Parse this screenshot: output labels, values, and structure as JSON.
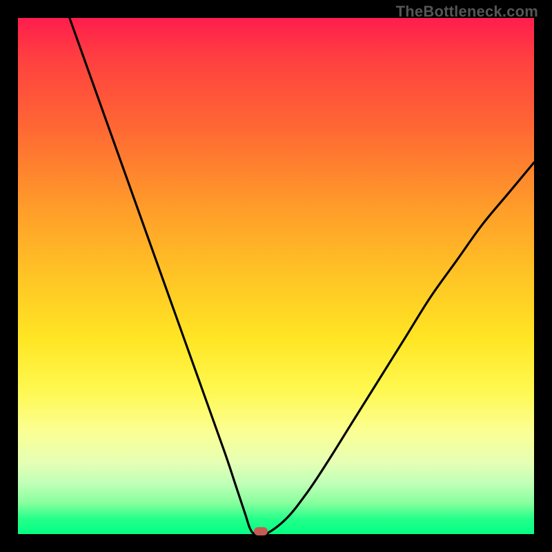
{
  "watermark": "TheBottleneck.com",
  "chart_data": {
    "type": "line",
    "title": "",
    "xlabel": "",
    "ylabel": "",
    "xlim": [
      0,
      100
    ],
    "ylim": [
      0,
      100
    ],
    "grid": false,
    "series": [
      {
        "name": "curve",
        "x": [
          10,
          15,
          20,
          25,
          30,
          35,
          40,
          42,
          44,
          45,
          46,
          48,
          52,
          56,
          60,
          65,
          70,
          75,
          80,
          85,
          90,
          95,
          100
        ],
        "y": [
          100,
          86,
          72,
          58,
          44,
          30,
          16,
          10,
          4,
          1,
          0,
          0,
          3,
          8,
          14,
          22,
          30,
          38,
          46,
          53,
          60,
          66,
          72
        ]
      }
    ],
    "minimum_marker": {
      "x": 47,
      "y": 0
    },
    "colors": {
      "curve": "#000000",
      "marker": "#c65a55",
      "gradient_top": "#ff1d4d",
      "gradient_bottom": "#03ff83",
      "frame": "#000000"
    }
  }
}
